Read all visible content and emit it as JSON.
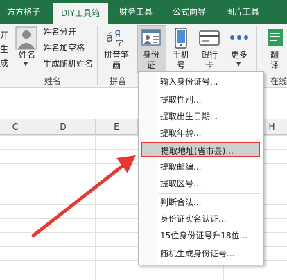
{
  "tabs": [
    "方方格子",
    "DIY工具箱",
    "财务工具",
    "公式向导",
    "图片工具"
  ],
  "ribbon": {
    "left_partial": [
      "开",
      "生",
      "成"
    ],
    "name_button": "姓名",
    "name_group_items": [
      "姓名分开",
      "姓名加空格",
      "生成随机姓名"
    ],
    "name_group_label": "姓名",
    "pinyin_button": [
      "拼音笔",
      "画"
    ],
    "pinyin_group_label": "拼音",
    "id_button": [
      "身份",
      "证"
    ],
    "phone_button": [
      "手机",
      "号"
    ],
    "bank_button": [
      "银行",
      "卡"
    ],
    "more_button": "更多",
    "translate_button": [
      "翻",
      "译"
    ],
    "online_partial": "在线"
  },
  "columns": [
    "C",
    "D",
    "E",
    "H"
  ],
  "menu": {
    "items": [
      "输入身份证号...",
      "提取性别...",
      "提取出生日期...",
      "提取年龄...",
      "提取地址(省市县)...",
      "提取邮编...",
      "提取区号...",
      "判断合法...",
      "身份证实名认证...",
      "15位身份证号升18位...",
      "随机生成身份证号..."
    ],
    "highlighted_index": 4
  },
  "colors": {
    "excel_green": "#217346",
    "highlight_border": "#e53935",
    "arrow": "#e53935"
  }
}
